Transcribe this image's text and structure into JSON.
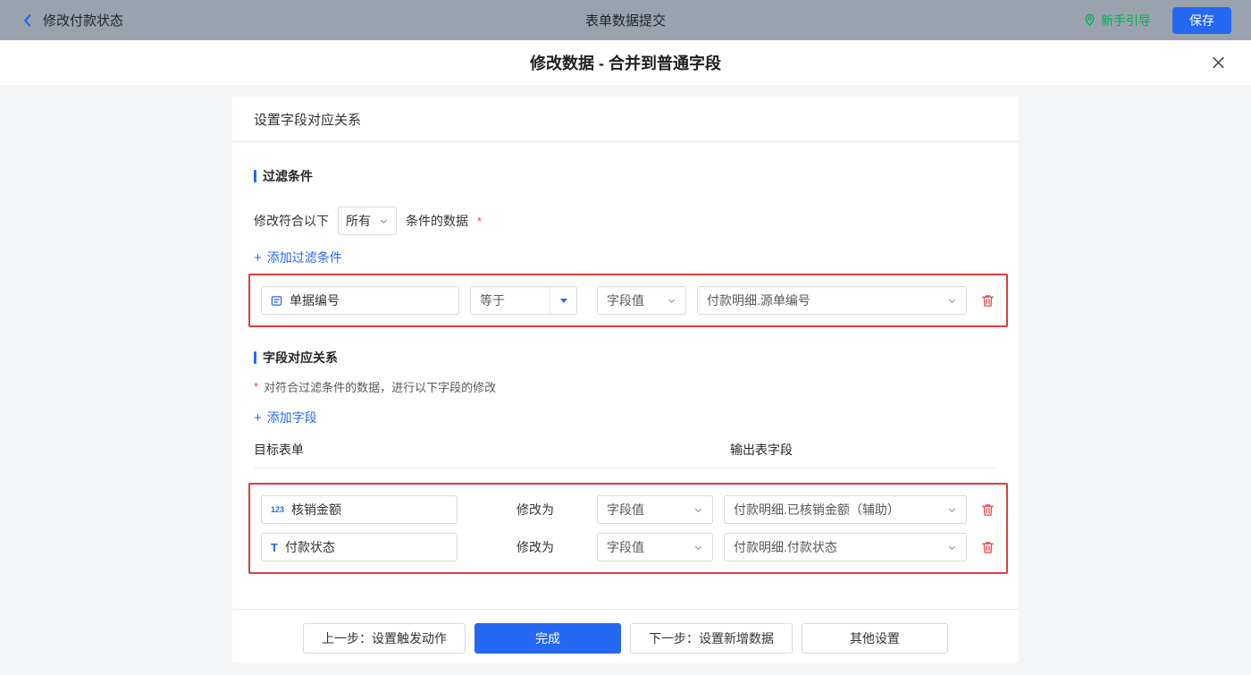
{
  "topbar": {
    "back_label": "修改付款状态",
    "title": "表单数据提交",
    "guide_label": "新手引导",
    "save_label": "保存"
  },
  "dialog": {
    "title": "修改数据 - 合并到普通字段"
  },
  "card": {
    "title": "设置字段对应关系"
  },
  "filter": {
    "section_label": "过滤条件",
    "sentence_prefix": "修改符合以下",
    "match_value": "所有",
    "sentence_suffix": "条件的数据",
    "required_mark": "*",
    "add_label": "添加过滤条件",
    "row": {
      "field_label": "单据编号",
      "operator": "等于",
      "value_type": "字段值",
      "value": "付款明细.源单编号"
    }
  },
  "mapping": {
    "section_label": "字段对应关系",
    "required_mark": "*",
    "hint": "对符合过滤条件的数据，进行以下字段的修改",
    "add_label": "添加字段",
    "columns": {
      "target": "目标表单",
      "output": "输出表字段"
    },
    "modify_label": "修改为",
    "rows": [
      {
        "field_icon": "123",
        "field_label": "核销金额",
        "value_type": "字段值",
        "value": "付款明细.已核销金额（辅助）"
      },
      {
        "field_icon": "T",
        "field_label": "付款状态",
        "value_type": "字段值",
        "value": "付款明细.付款状态"
      }
    ]
  },
  "footer": {
    "prev_label": "上一步：设置触发动作",
    "done_label": "完成",
    "next_label": "下一步：设置新增数据",
    "other_label": "其他设置"
  },
  "colors": {
    "accent": "#2468f2",
    "danger": "#e23c3c",
    "success": "#00b050",
    "topbar_bg": "#9aa3ad"
  }
}
